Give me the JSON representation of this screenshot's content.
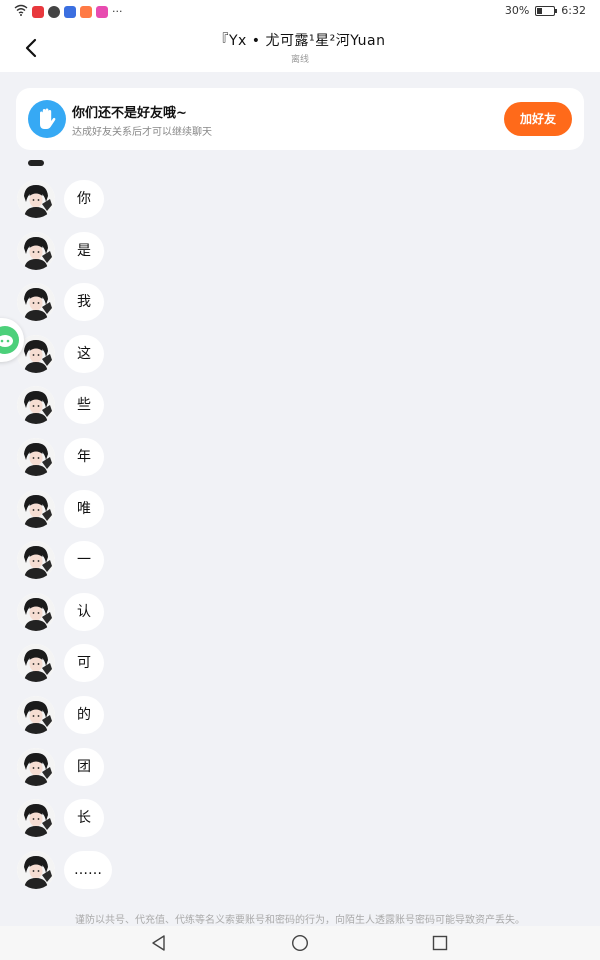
{
  "status_bar": {
    "battery_percent": "30%",
    "battery_level": 0.3,
    "time": "6:32",
    "more_indicator": "···"
  },
  "header": {
    "title": "『Yx • 尤可露¹星²河Yuan",
    "subtitle": "离线"
  },
  "friend_banner": {
    "title": "你们还不是好友哦~",
    "subtitle": "达成好友关系后才可以继续聊天",
    "add_label": "加好友"
  },
  "messages": [
    {
      "text": "你"
    },
    {
      "text": "是"
    },
    {
      "text": "我"
    },
    {
      "text": "这"
    },
    {
      "text": "些"
    },
    {
      "text": "年"
    },
    {
      "text": "唯"
    },
    {
      "text": "一"
    },
    {
      "text": "认"
    },
    {
      "text": "可"
    },
    {
      "text": "的"
    },
    {
      "text": "团"
    },
    {
      "text": "长"
    },
    {
      "text": "……"
    }
  ],
  "warning": "谨防以共号、代充值、代练等名义索要账号和密码的行为，向陌生人透露账号密码可能导致资产丢失。",
  "colors": {
    "accent": "#ff6a1a",
    "hand_icon": "#36a9f4",
    "background": "#f1f2f6"
  },
  "icons": {
    "back": "back-arrow-icon",
    "hand": "hand-wave-icon",
    "nav_back": "triangle-back-icon",
    "nav_home": "circle-home-icon",
    "nav_recent": "square-recent-icon"
  }
}
